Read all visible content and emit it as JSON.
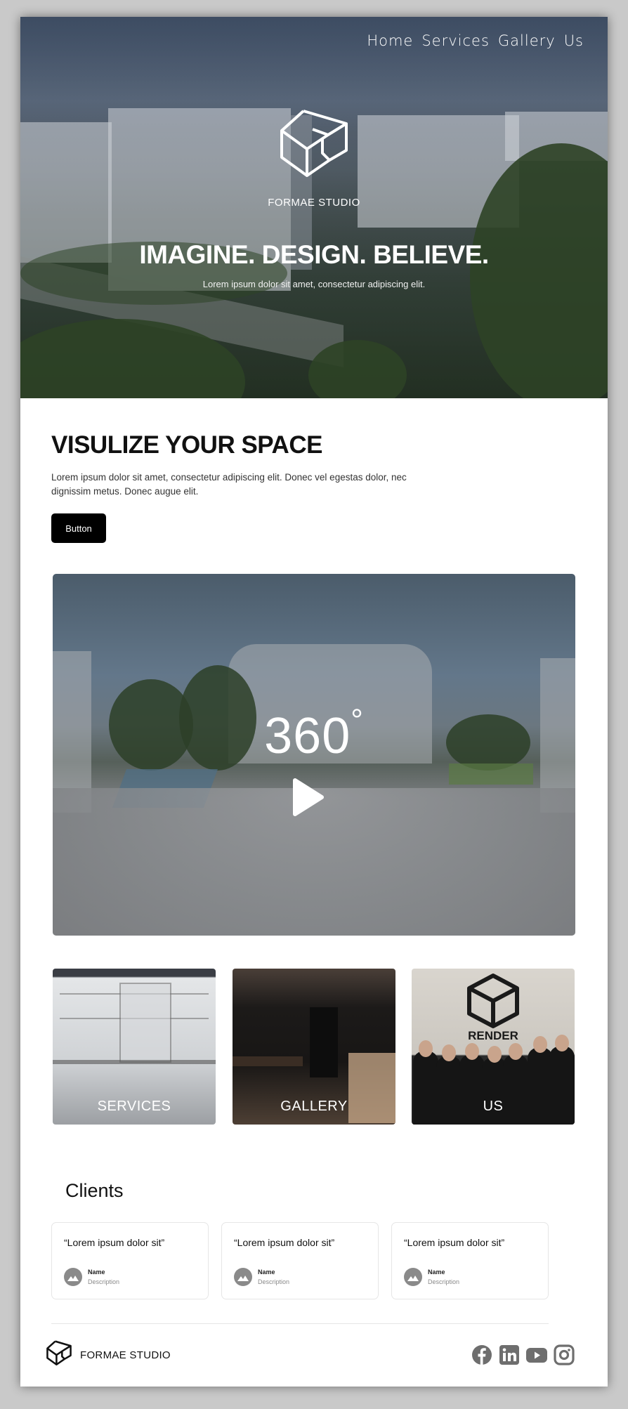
{
  "nav": {
    "links": [
      "Home",
      "Services",
      "Gallery",
      "Us"
    ]
  },
  "hero": {
    "brand": "FORMAE STUDIO",
    "headline": "IMAGINE. DESIGN. BELIEVE.",
    "subtitle": "Lorem ipsum dolor sit amet, consectetur adipiscing elit."
  },
  "visualize": {
    "title": "VISULIZE YOUR SPACE",
    "text": "Lorem ipsum dolor sit amet, consectetur adipiscing elit. Donec vel egestas dolor, nec dignissim metus. Donec augue elit.",
    "button_label": "Button"
  },
  "pano": {
    "label": "360",
    "degree": "°"
  },
  "cards": [
    "SERVICES",
    "GALLERY",
    "US"
  ],
  "clients": {
    "title": "Clients",
    "testimonials": [
      {
        "quote": "“Lorem ipsum dolor sit”",
        "name": "Name",
        "description": "Description"
      },
      {
        "quote": "“Lorem ipsum dolor sit”",
        "name": "Name",
        "description": "Description"
      },
      {
        "quote": "“Lorem ipsum dolor sit”",
        "name": "Name",
        "description": "Description"
      }
    ]
  },
  "footer": {
    "brand": "FORMAE STUDIO",
    "social_icons": [
      "facebook-icon",
      "linkedin-icon",
      "youtube-icon",
      "instagram-icon"
    ]
  },
  "colors": {
    "button": "#000000",
    "social_icon": "#6e6e6e"
  }
}
